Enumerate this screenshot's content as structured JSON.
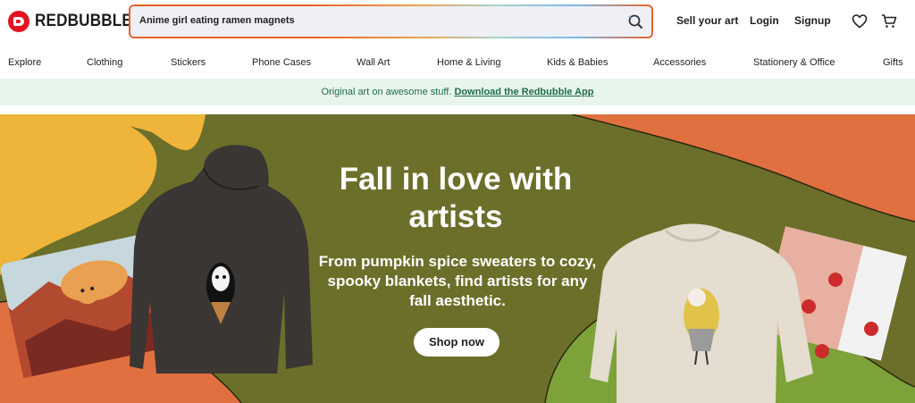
{
  "header": {
    "brand": "REDBUBBLE",
    "search_value": "Anime girl eating ramen magnets",
    "sell_label": "Sell your art",
    "login_label": "Login",
    "signup_label": "Signup",
    "icons": [
      "search-icon",
      "heart-icon",
      "cart-icon"
    ]
  },
  "categories": [
    "Explore",
    "Clothing",
    "Stickers",
    "Phone Cases",
    "Wall Art",
    "Home & Living",
    "Kids & Babies",
    "Accessories",
    "Stationery & Office",
    "Gifts"
  ],
  "promo": {
    "text": "Original art on awesome stuff.",
    "link": "Download the Redbubble App"
  },
  "hero": {
    "title": "Fall in love with artists",
    "subtitle": "From pumpkin spice sweaters to cozy, spooky blankets, find artists for any fall aesthetic.",
    "cta": "Shop now"
  },
  "colors": {
    "brand_red": "#e41321",
    "hero_olive": "#6c6f2a",
    "promo_bg": "#e8f5ec",
    "promo_text": "#1f6e4a"
  }
}
